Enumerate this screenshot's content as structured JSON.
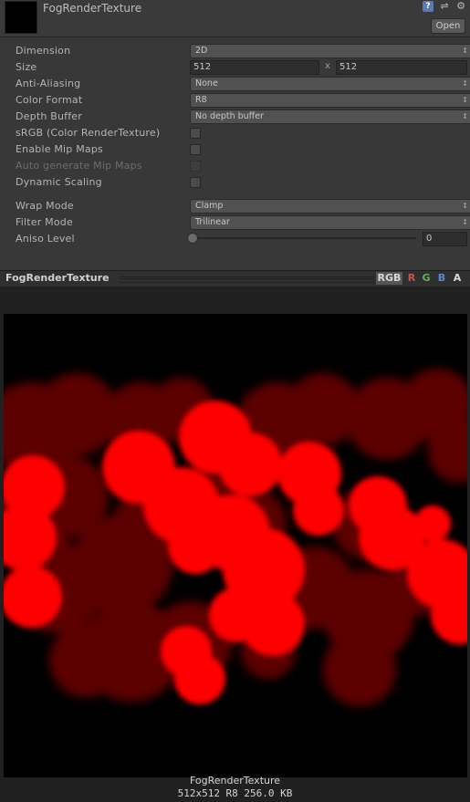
{
  "header": {
    "title": "FogRenderTexture",
    "open_label": "Open",
    "icons": [
      "help-icon",
      "preset-icon",
      "gear-icon"
    ]
  },
  "inspector": {
    "dimension": {
      "label": "Dimension",
      "value": "2D"
    },
    "size": {
      "label": "Size",
      "width": "512",
      "separator": "x",
      "height": "512"
    },
    "anti_aliasing": {
      "label": "Anti-Aliasing",
      "value": "None"
    },
    "color_format": {
      "label": "Color Format",
      "value": "R8"
    },
    "depth_buffer": {
      "label": "Depth Buffer",
      "value": "No depth buffer"
    },
    "srgb": {
      "label": "sRGB (Color RenderTexture)",
      "checked": false
    },
    "enable_mip_maps": {
      "label": "Enable Mip Maps",
      "checked": false
    },
    "auto_generate_mip_maps": {
      "label": "Auto generate Mip Maps",
      "checked": false,
      "disabled": true
    },
    "dynamic_scaling": {
      "label": "Dynamic Scaling",
      "checked": false
    },
    "wrap_mode": {
      "label": "Wrap Mode",
      "value": "Clamp"
    },
    "filter_mode": {
      "label": "Filter Mode",
      "value": "Trilinear"
    },
    "aniso_level": {
      "label": "Aniso Level",
      "value": "0"
    }
  },
  "preview": {
    "title": "FogRenderTexture",
    "channels": [
      "RGB",
      "R",
      "G",
      "B",
      "A"
    ],
    "info_name": "FogRenderTexture",
    "info_details": "512x512  R8  256.0 KB",
    "colors": {
      "bright": "#ff0000",
      "dim": "#5a0000",
      "background": "#000000"
    }
  }
}
